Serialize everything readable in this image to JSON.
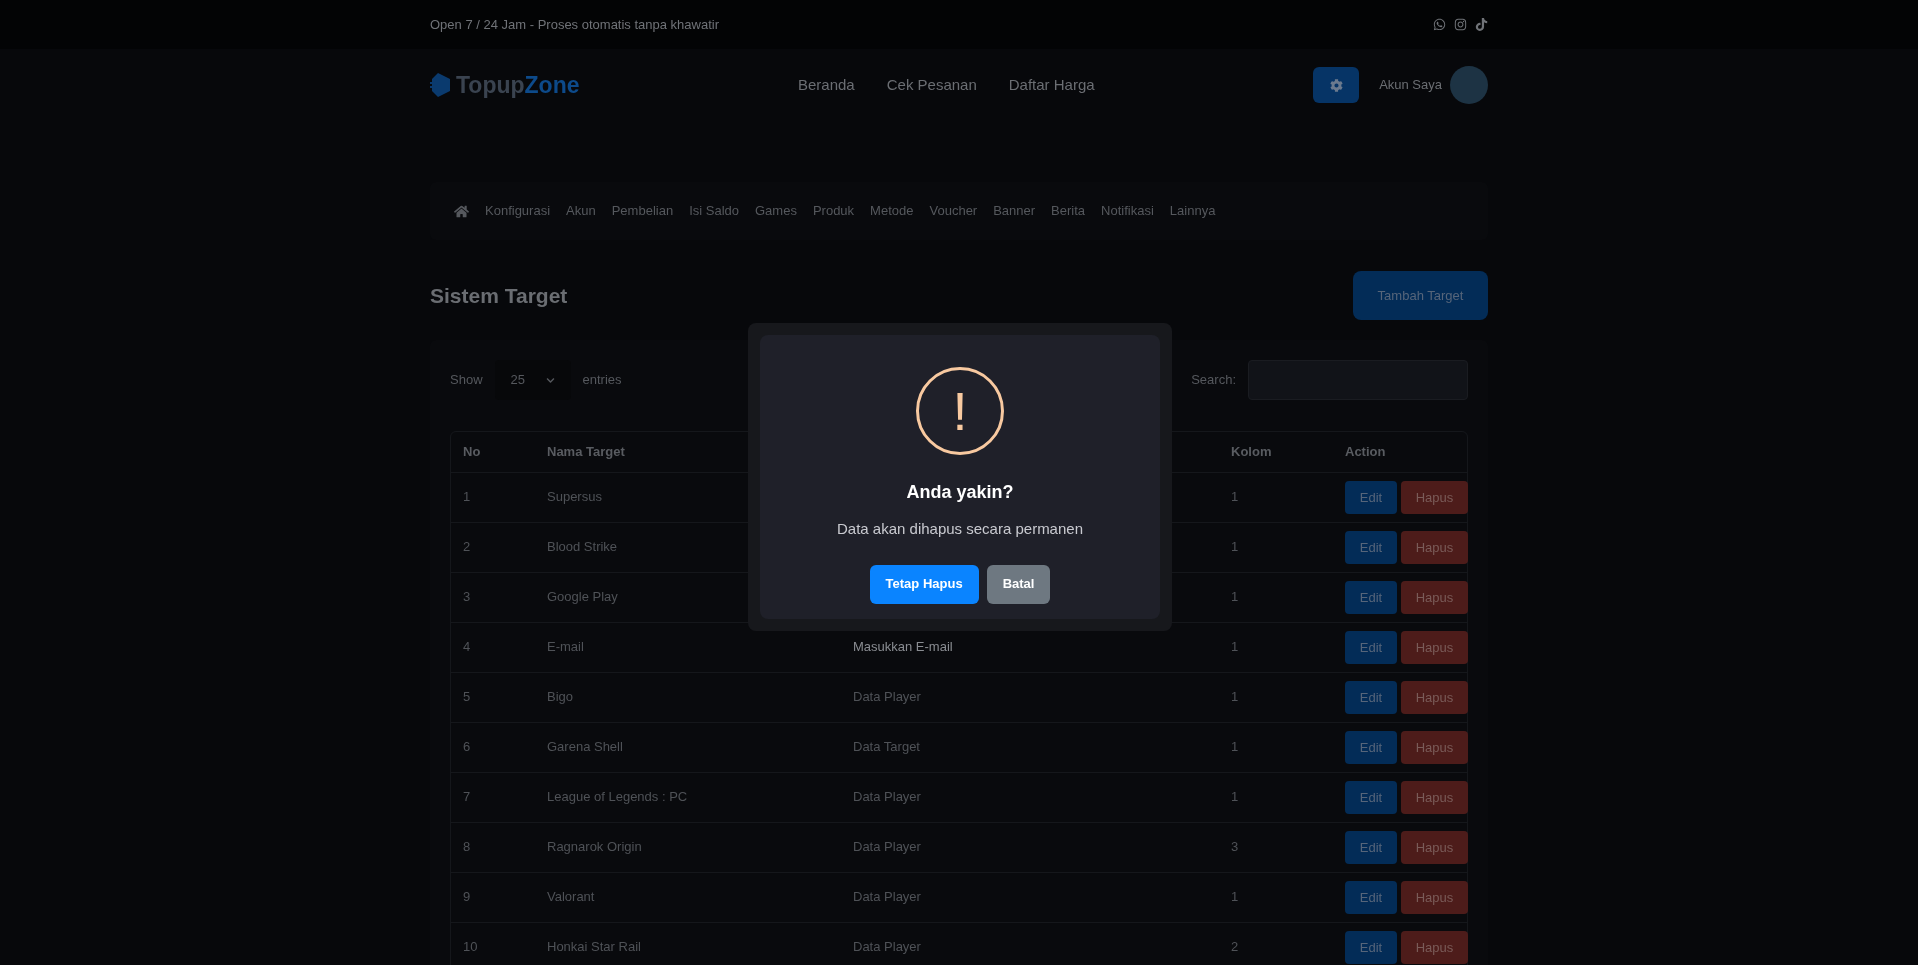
{
  "top_bar": {
    "text": "Open 7 / 24 Jam - Proses otomatis tanpa khawatir"
  },
  "header": {
    "logo": {
      "first": "Topup",
      "second": "Zone"
    },
    "nav": [
      "Beranda",
      "Cek Pesanan",
      "Daftar Harga"
    ],
    "account": "Akun Saya"
  },
  "admin_menu": [
    "Konfigurasi",
    "Akun",
    "Pembelian",
    "Isi Saldo",
    "Games",
    "Produk",
    "Metode",
    "Voucher",
    "Banner",
    "Berita",
    "Notifikasi",
    "Lainnya"
  ],
  "page": {
    "title": "Sistem Target",
    "add_button": "Tambah Target"
  },
  "table_controls": {
    "show": "Show",
    "page_size": "25",
    "entries": "entries",
    "search": "Search:"
  },
  "table": {
    "columns": [
      "No",
      "Nama Target",
      "",
      "Kolom",
      "Action"
    ],
    "rows": [
      {
        "no": "1",
        "name": "Supersus",
        "kolom": "1",
        "edit": "Edit",
        "delete": "Hapus"
      },
      {
        "no": "2",
        "name": "Blood Strike",
        "kolom": "1",
        "edit": "Edit",
        "delete": "Hapus"
      },
      {
        "no": "3",
        "name": "Google Play",
        "kolom": "1",
        "edit": "Edit",
        "delete": "Hapus"
      },
      {
        "no": "4",
        "name": "E-mail",
        "column_3": "Masukkan E-mail",
        "kolom": "1",
        "edit": "Edit",
        "delete": "Hapus"
      },
      {
        "no": "5",
        "name": "Bigo",
        "column_3": "Data Player",
        "kolom": "1",
        "edit": "Edit",
        "delete": "Hapus"
      },
      {
        "no": "6",
        "name": "Garena Shell",
        "column_3": "Data Target",
        "kolom": "1",
        "edit": "Edit",
        "delete": "Hapus"
      },
      {
        "no": "7",
        "name": "League of Legends : PC",
        "column_3": "Data Player",
        "kolom": "1",
        "edit": "Edit",
        "delete": "Hapus"
      },
      {
        "no": "8",
        "name": "Ragnarok Origin",
        "column_3": "Data Player",
        "kolom": "3",
        "edit": "Edit",
        "delete": "Hapus"
      },
      {
        "no": "9",
        "name": "Valorant",
        "column_3": "Data Player",
        "kolom": "1",
        "edit": "Edit",
        "delete": "Hapus"
      },
      {
        "no": "10",
        "name": "Honkai Star Rail",
        "column_3": "Data Player",
        "kolom": "2",
        "edit": "Edit",
        "delete": "Hapus"
      }
    ]
  },
  "dialog": {
    "icon": "!",
    "title": "Anda yakin?",
    "message": "Data akan dihapus secara permanen",
    "confirm": "Tetap Hapus",
    "cancel": "Batal"
  }
}
